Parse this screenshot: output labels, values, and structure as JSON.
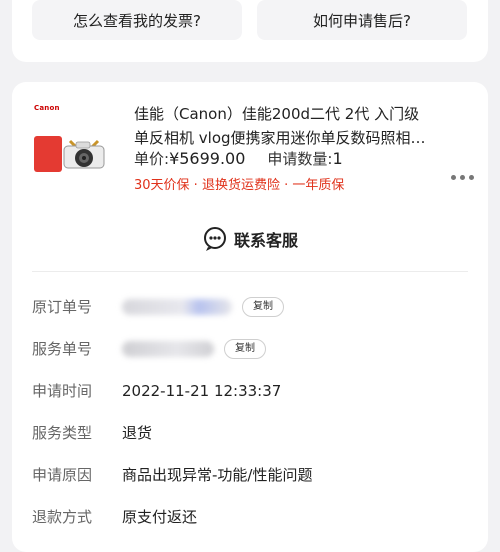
{
  "help": {
    "invoice_question": "怎么查看我的发票?",
    "aftersale_question": "如何申请售后?"
  },
  "product": {
    "brand_logo": "Canon",
    "title": "佳能（Canon）佳能200d二代 2代 入门级单反相机 vlog便携家用迷你单反数码照相机 ...",
    "price_label": "单价:",
    "price": "¥5699.00",
    "qty_label": "申请数量:",
    "qty": "1",
    "guarantees": "30天价保 · 退换货运费险 · 一年质保",
    "more_icon": "more-dots-icon"
  },
  "service": {
    "label": "联系客服",
    "icon": "customer-service-icon"
  },
  "details": {
    "rows": [
      {
        "key": "原订单号",
        "value": "",
        "copy": "复制"
      },
      {
        "key": "服务单号",
        "value": "",
        "copy": "复制"
      },
      {
        "key": "申请时间",
        "value": "2022-11-21 12:33:37"
      },
      {
        "key": "服务类型",
        "value": "退货"
      },
      {
        "key": "申请原因",
        "value": "商品出现异常-功能/性能问题"
      },
      {
        "key": "退款方式",
        "value": "原支付返还"
      }
    ]
  },
  "colors": {
    "accent_red": "#e0321b",
    "background": "#f2f2f4",
    "card": "#ffffff"
  }
}
